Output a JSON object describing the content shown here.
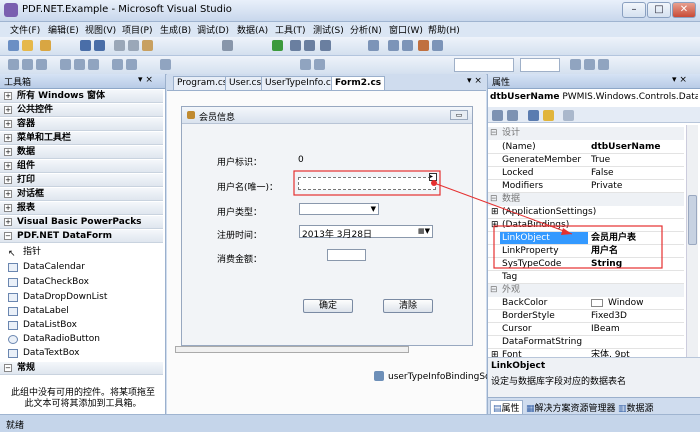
{
  "window": {
    "title": "PDF.NET.Example - Microsoft Visual Studio",
    "min": "–",
    "max": "□",
    "close": "✕"
  },
  "menu": [
    "文件(F)",
    "编辑(E)",
    "视图(V)",
    "项目(P)",
    "生成(B)",
    "调试(D)",
    "数据(A)",
    "工具(T)",
    "测试(S)",
    "分析(N)",
    "窗口(W)",
    "帮助(H)"
  ],
  "toolbox": {
    "title": "工具箱",
    "categories": [
      "所有 Windows 窗体",
      "公共控件",
      "容器",
      "菜单和工具栏",
      "数据",
      "组件",
      "打印",
      "对话框",
      "报表",
      "Visual Basic PowerPacks",
      "PDF.NET DataForm"
    ],
    "items": [
      "指针",
      "DataCalendar",
      "DataCheckBox",
      "DataDropDownList",
      "DataLabel",
      "DataListBox",
      "DataRadioButton",
      "DataTextBox"
    ],
    "last_category": "常规",
    "empty_text": "此组中没有可用的控件。将某项拖至此文本可将其添加到工具箱。"
  },
  "tabs": [
    "Program.cs",
    "User.cs",
    "UserTypeInfo.cs",
    "Form2.cs"
  ],
  "form": {
    "title": "会员信息",
    "labels": [
      "用户标识：",
      "用户名(唯一)：",
      "用户类型：",
      "注册时间：",
      "消费金额："
    ],
    "id_value": "0",
    "date_value": "2013年 3月28日",
    "ok": "确定",
    "cancel": "清除"
  },
  "component_tray": "userTypeInfoBindingSou",
  "properties": {
    "title": "属性",
    "object_name": "dtbUserName",
    "object_type": "PWMIS.Windows.Controls.DataTe",
    "design_cat": "设计",
    "data_cat": "数据",
    "appearance_cat": "外观",
    "rows1": [
      [
        "(Name)",
        "dtbUserName"
      ],
      [
        "GenerateMember",
        "True"
      ],
      [
        "Locked",
        "False"
      ],
      [
        "Modifiers",
        "Private"
      ]
    ],
    "rows2": [
      [
        "(ApplicationSettings)",
        ""
      ],
      [
        "(DataBindings)",
        ""
      ],
      [
        "LinkObject",
        "会员用户表"
      ],
      [
        "LinkProperty",
        "用户名"
      ],
      [
        "SysTypeCode",
        "String"
      ],
      [
        "Tag",
        ""
      ]
    ],
    "rows3": [
      [
        "BackColor",
        "Window"
      ],
      [
        "BorderStyle",
        "Fixed3D"
      ],
      [
        "Cursor",
        "IBeam"
      ],
      [
        "DataFormatString",
        ""
      ],
      [
        "Font",
        "宋体, 9pt"
      ]
    ],
    "desc_title": "LinkObject",
    "desc_text": "设定与数据库字段对应的数据表名",
    "bottom_tabs": [
      "属性",
      "解决方案资源管理器",
      "数据源"
    ]
  },
  "status": "就绪"
}
